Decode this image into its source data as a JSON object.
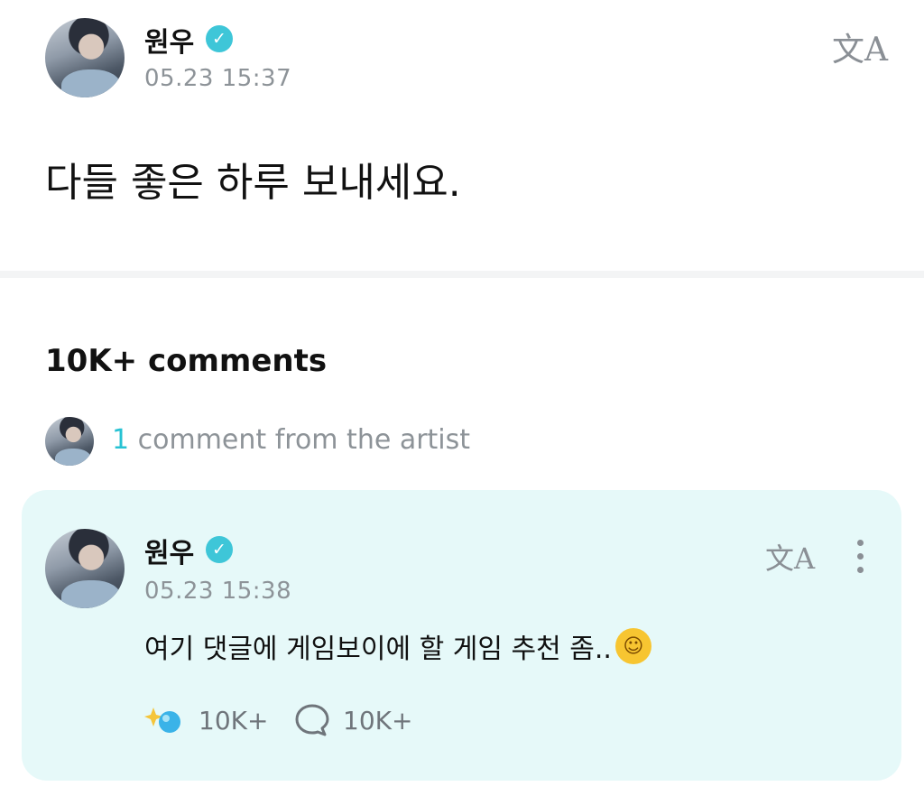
{
  "post": {
    "author": "원우",
    "timestamp": "05.23 15:37",
    "text": "다들 좋은 하루 보내세요.",
    "translate_icon": "translate-icon",
    "verified_icon": "verified-badge-icon"
  },
  "comments": {
    "count_label": "10K+ comments",
    "artist_count": "1",
    "artist_label": "comment from the artist"
  },
  "artist_comment": {
    "author": "원우",
    "timestamp": "05.23 15:38",
    "text": "여기 댓글에 게임보이에 할 게임 추천 좀..",
    "emoji": "grinning-sweat-emoji",
    "like_count": "10K+",
    "reply_count": "10K+",
    "like_icon": "sparkle-like-icon",
    "reply_icon": "speech-bubble-icon",
    "more_icon": "more-vertical-icon"
  },
  "colors": {
    "accent": "#27c2d3",
    "card_bg": "#e6f9f9",
    "muted": "#8d9398"
  }
}
